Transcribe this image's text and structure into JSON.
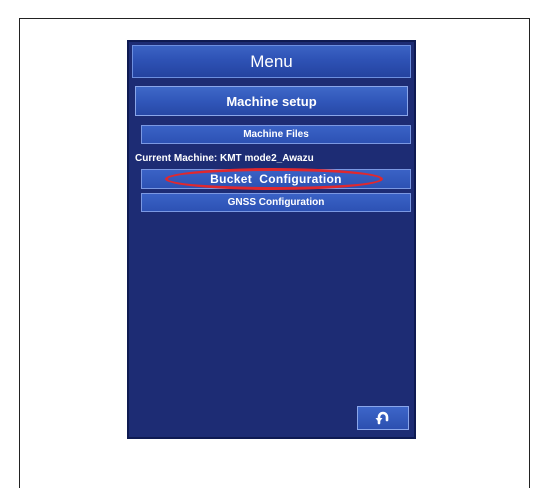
{
  "menu": {
    "title": "Menu"
  },
  "machine_setup": {
    "header": "Machine setup",
    "machine_files_label": "Machine Files",
    "current_machine_text": "Current Machine: KMT mode2_Awazu",
    "bucket_configuration_label": "Bucket  Configuration",
    "gnss_configuration_label": "GNSS Configuration"
  },
  "icons": {
    "back": "back-arrow-icon"
  },
  "colors": {
    "panel_background": "#1d2c74",
    "button_blue": "#2d52b4",
    "highlight_red": "#e0282e"
  }
}
